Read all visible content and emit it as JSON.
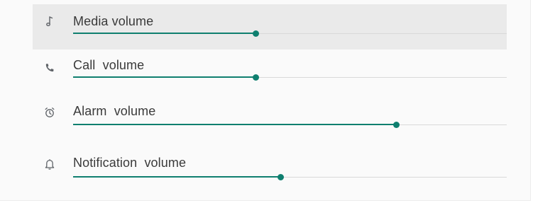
{
  "colors": {
    "accent": "#0f7f6f",
    "track": "#d9d9d9",
    "highlight_row": "#eaeaea",
    "background": "#fafafa",
    "label_text": "#3a3a3a",
    "icon": "#5f6368"
  },
  "volume_rows": [
    {
      "label": "Media volume",
      "icon": "music-note-icon",
      "level": 0.42,
      "highlighted": true
    },
    {
      "label": "Call  volume",
      "icon": "phone-icon",
      "level": 0.42,
      "highlighted": false
    },
    {
      "label": "Alarm  volume",
      "icon": "alarm-clock-icon",
      "level": 0.745,
      "highlighted": false
    },
    {
      "label": "Notification  volume",
      "icon": "bell-icon",
      "level": 0.478,
      "highlighted": false
    }
  ]
}
